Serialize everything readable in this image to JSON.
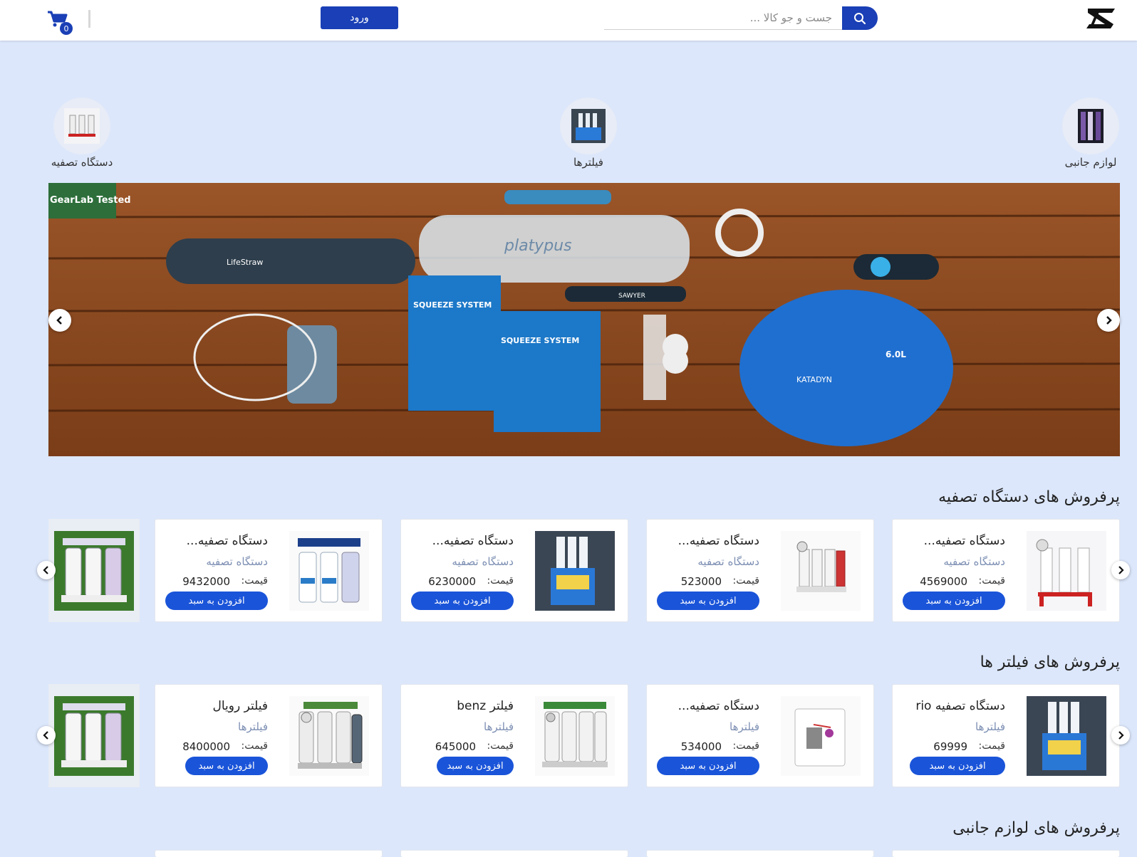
{
  "header": {
    "search_placeholder": "جست و جو کالا ...",
    "login_label": "ورود",
    "cart_count": "0",
    "brand_color": "#1a3fb6"
  },
  "categories": [
    {
      "label": "لوازم جانبی",
      "icon": "accessories-thumb"
    },
    {
      "label": "فیلترها",
      "icon": "filters-thumb"
    },
    {
      "label": "دستگاه تصفیه",
      "icon": "purifier-thumb"
    }
  ],
  "banner": {
    "label_badge": "GearLab Tested",
    "product_labels": [
      "LifeStraw",
      "SQUEEZE SYSTEM",
      "SQUEEZE SYSTEM",
      "SAWYER",
      "6.0L",
      "KATADYN",
      "platypus"
    ]
  },
  "sections": [
    {
      "title": "پرفروش های دستگاه تصفیه",
      "products": [
        {
          "title": "دستگاه تصفیه...",
          "category": "دستگاه تصفیه",
          "price_label": "قیمت:",
          "price": "4569000",
          "button": "افزودن به سبد"
        },
        {
          "title": "دستگاه تصفیه...",
          "category": "دستگاه تصفیه",
          "price_label": "قیمت:",
          "price": "523000",
          "button": "افزودن به سبد"
        },
        {
          "title": "دستگاه تصفیه...",
          "category": "دستگاه تصفیه",
          "price_label": "قیمت:",
          "price": "6230000",
          "button": "افزودن به سبد"
        },
        {
          "title": "دستگاه تصفیه...",
          "category": "دستگاه تصفیه",
          "price_label": "قیمت:",
          "price": "9432000",
          "button": "افزودن به سبد"
        }
      ]
    },
    {
      "title": "پرفروش های فیلتر ها",
      "products": [
        {
          "title": "دستگاه تصفیه rio",
          "category": "فیلترها",
          "price_label": "قیمت:",
          "price": "69999",
          "button": "افزودن به سبد"
        },
        {
          "title": "دستگاه تصفیه...",
          "category": "فیلترها",
          "price_label": "قیمت:",
          "price": "534000",
          "button": "افزودن به سبد"
        },
        {
          "title": "فیلتر benz",
          "category": "فیلترها",
          "price_label": "قیمت:",
          "price": "645000",
          "button": "افزودن به سبد"
        },
        {
          "title": "فیلتر رویال",
          "category": "فیلترها",
          "price_label": "قیمت:",
          "price": "8400000",
          "button": "افزودن به سبد"
        }
      ]
    },
    {
      "title": "پرفروش های لوازم جانبی"
    }
  ]
}
